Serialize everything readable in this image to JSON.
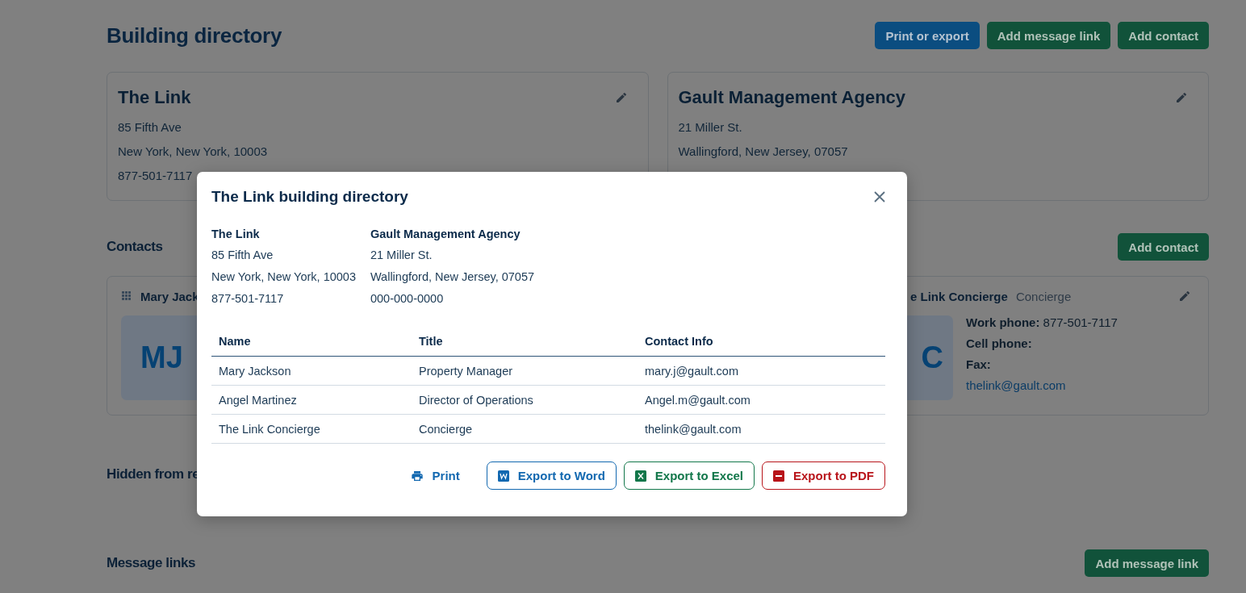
{
  "header": {
    "title": "Building directory",
    "buttons": [
      {
        "label": "Print or export",
        "kind": "blue"
      },
      {
        "label": "Add message link",
        "kind": "green"
      },
      {
        "label": "Add contact",
        "kind": "green"
      }
    ]
  },
  "properties": [
    {
      "name": "The Link",
      "lines": [
        "85 Fifth Ave",
        "New York, New York, 10003",
        "877-501-7117"
      ]
    },
    {
      "name": "Gault Management Agency",
      "lines": [
        "21 Miller St.",
        "Wallingford, New Jersey, 07057"
      ]
    }
  ],
  "contacts": {
    "heading": "Contacts",
    "button": "Add contact",
    "cards": [
      {
        "name": "Mary Jack",
        "initials": "MJ",
        "drag_handle": true,
        "edit": false
      },
      {
        "name": "e Link Concierge",
        "title": "Concierge",
        "initials": "C",
        "drag_handle": false,
        "edit": true,
        "fields": [
          {
            "label": "Work phone:",
            "value": "877-501-7117"
          },
          {
            "label": "Cell phone:"
          },
          {
            "label": "Fax:"
          }
        ],
        "email": "thelink@gault.com"
      }
    ]
  },
  "hidden": {
    "heading": "Hidden from re"
  },
  "message_links": {
    "heading": "Message links",
    "button": "Add message link"
  },
  "modal": {
    "title": "The Link building directory",
    "addresses": [
      {
        "name": "The Link",
        "lines": [
          "85 Fifth Ave",
          "New York, New York, 10003",
          "877-501-7117"
        ]
      },
      {
        "name": "Gault Management Agency",
        "lines": [
          "21 Miller St.",
          "Wallingford, New Jersey, 07057",
          "000-000-0000"
        ]
      }
    ],
    "columns": [
      "Name",
      "Title",
      "Contact Info"
    ],
    "rows": [
      [
        "Mary Jackson",
        "Property Manager",
        "mary.j@gault.com"
      ],
      [
        "Angel Martinez",
        "Director of Operations",
        "Angel.m@gault.com"
      ],
      [
        "The Link Concierge",
        "Concierge",
        "thelink@gault.com"
      ]
    ],
    "actions": [
      {
        "label": "Print",
        "kind": "print"
      },
      {
        "label": "Export to Word",
        "kind": "word"
      },
      {
        "label": "Export to Excel",
        "kind": "excel"
      },
      {
        "label": "Export to PDF",
        "kind": "pdf"
      }
    ]
  }
}
